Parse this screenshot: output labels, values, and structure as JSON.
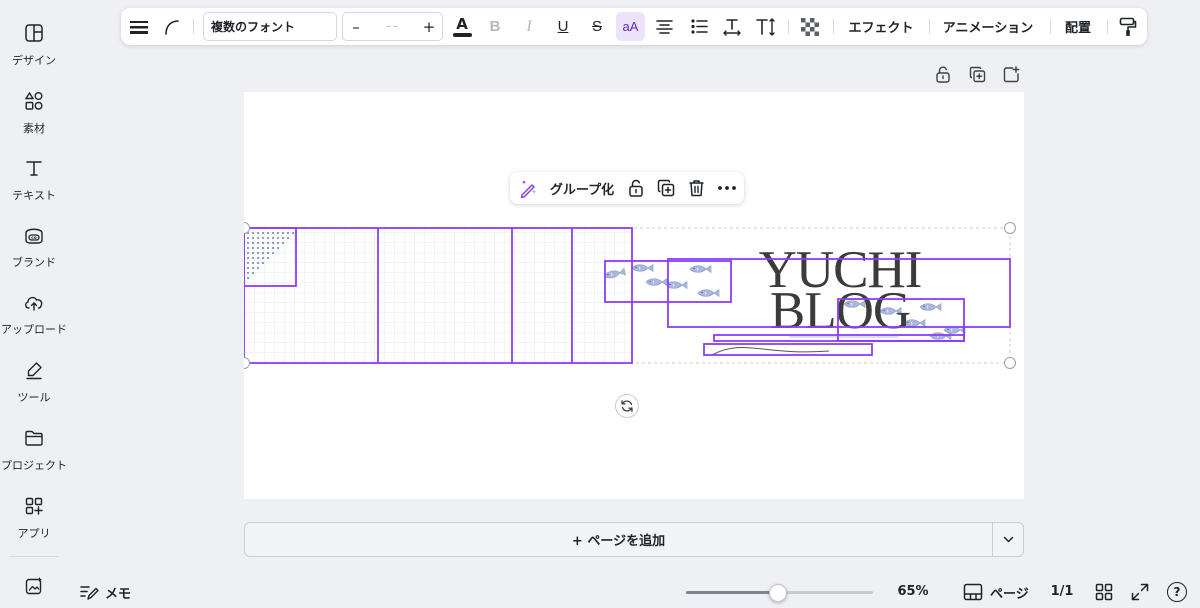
{
  "sidebar": {
    "items": [
      {
        "label": "デザイン",
        "icon": "layout-icon"
      },
      {
        "label": "素材",
        "icon": "shapes-icon"
      },
      {
        "label": "テキスト",
        "icon": "text-icon"
      },
      {
        "label": "ブランド",
        "icon": "brand-icon"
      },
      {
        "label": "アップロード",
        "icon": "cloud-upload-icon"
      },
      {
        "label": "ツール",
        "icon": "pen-tool-icon"
      },
      {
        "label": "プロジェクト",
        "icon": "folder-icon"
      },
      {
        "label": "アプリ",
        "icon": "apps-icon"
      }
    ],
    "magic_icon": "magic-media-icon"
  },
  "toolbar": {
    "font_family": "複数のフォント",
    "font_size_minus": "–",
    "font_size_value": "--",
    "font_size_plus": "+",
    "text_color_letter": "A",
    "bold": "B",
    "italic": "I",
    "underline": "U",
    "strikethrough": "S",
    "case_label": "aA",
    "effects_label": "エフェクト",
    "animate_label": "アニメーション",
    "position_label": "配置"
  },
  "context_toolbar": {
    "group_label": "グループ化"
  },
  "canvas": {
    "title_line1": "YUCHI",
    "title_line2": "BLOG"
  },
  "add_page": {
    "label": "+ ページを追加"
  },
  "bottom_bar": {
    "notes_label": "メモ",
    "zoom_value": "65%",
    "zoom_fraction": 0.49,
    "pages_label": "ページ",
    "page_count": "1/1",
    "help_label": "?"
  },
  "colors": {
    "selection": "#8b3dff",
    "fish": "#9fb0d8",
    "accent_bg": "#ece3fb"
  }
}
